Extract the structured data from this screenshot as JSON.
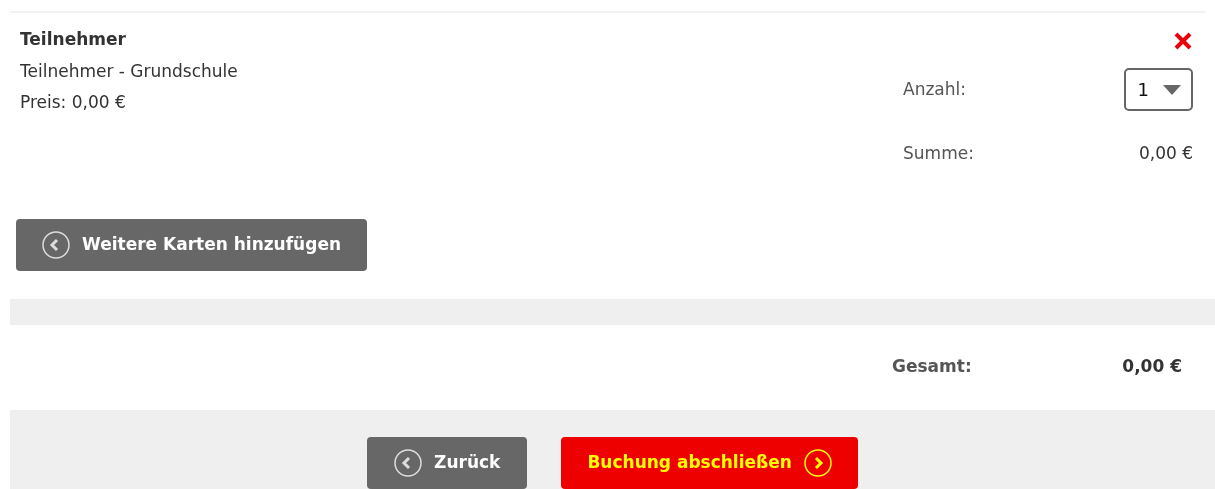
{
  "item": {
    "title": "Teilnehmer",
    "description": "Teilnehmer - Grundschule",
    "price": "Preis: 0,00 €",
    "quantity_label": "Anzahl:",
    "quantity": "1",
    "sum_label": "Summe:",
    "sum_value": "0,00 €"
  },
  "add_button": {
    "label": "Weitere Karten hinzufügen"
  },
  "total": {
    "label": "Gesamt:",
    "value": "0,00 €"
  },
  "footer_buttons": [
    {
      "label": "Zurück",
      "kind": "back"
    },
    {
      "label": "Buchung abschließen",
      "kind": "submit"
    }
  ]
}
